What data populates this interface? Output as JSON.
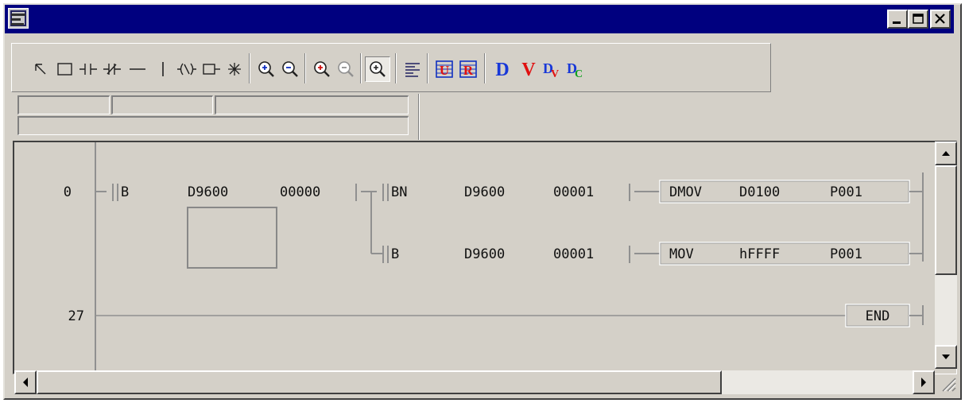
{
  "window": {
    "title": "",
    "controls": {
      "minimize": "minimize",
      "maximize": "maximize",
      "close": "close"
    }
  },
  "toolbar": {
    "tools": [
      "select-arrow-icon",
      "rectangle-select-icon",
      "contact-no-icon",
      "contact-nc-icon",
      "horizontal-line-icon",
      "vertical-line-icon",
      "coil-icon",
      "function-box-icon",
      "star-icon",
      "zoom-in-icon",
      "zoom-out-icon",
      "zoom-in-red-icon",
      "zoom-out-red-icon",
      "zoom-fit-icon",
      "align-text-icon",
      "u-register-icon",
      "r-register-icon",
      "d-blue-icon",
      "v-red-icon",
      "dv-icon",
      "dc-icon"
    ]
  },
  "colors": {
    "titlebar": "#00007f",
    "face": "#d4d0c8",
    "blue_letter": "#1838d8",
    "red_letter": "#e01010"
  },
  "ladder": {
    "rungs": [
      {
        "step": "0",
        "contacts": [
          {
            "type": "B",
            "operand1": "D9600",
            "operand2": "00000"
          },
          {
            "type": "BN",
            "operand1": "D9600",
            "operand2": "00001"
          }
        ],
        "instruction": {
          "op": "DMOV",
          "arg1": "D0100",
          "arg2": "P001"
        }
      },
      {
        "step": "",
        "contacts": [
          {
            "type": "B",
            "operand1": "D9600",
            "operand2": "00001"
          }
        ],
        "instruction": {
          "op": "MOV",
          "arg1": "hFFFF",
          "arg2": "P001"
        }
      },
      {
        "step": "27",
        "instruction": {
          "op": "END"
        }
      }
    ]
  }
}
